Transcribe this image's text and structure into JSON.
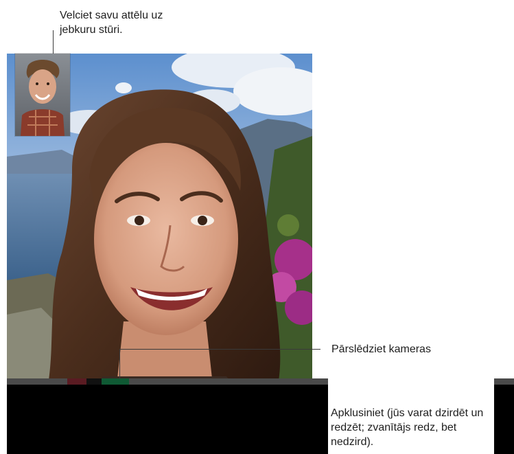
{
  "annotations": {
    "pip_callout": "Velciet savu attēlu uz jebkuru stūri.",
    "switch_camera_callout": "Pārslēdziet kameras",
    "mute_callout": "Apklusiniet (jūs varat dzirdēt un redzēt; zvanītājs redz, bet nedzird)."
  },
  "colors": {
    "control_bar": "#000000",
    "strip": "#4a4a4a",
    "end_call_accent": "#5a1b22",
    "switch_camera_accent": "#0f5a34"
  },
  "icons": {
    "main_video": "facetime-main-video",
    "pip_video": "facetime-self-view"
  }
}
